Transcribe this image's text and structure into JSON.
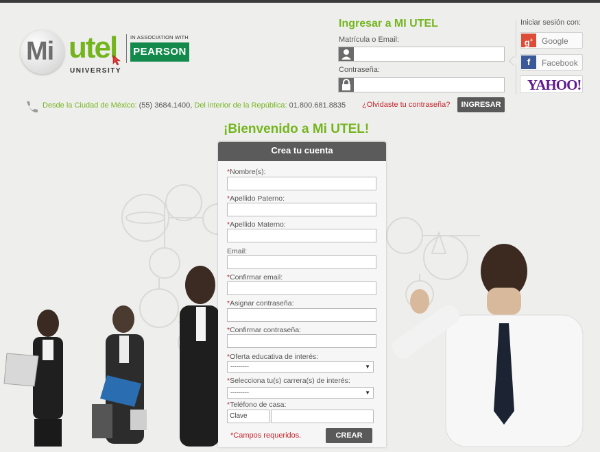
{
  "brand": {
    "logo_mi": "Mi",
    "logo_utel": "utel",
    "logo_university": "UNIVERSITY",
    "association": "IN ASSOCIATION WITH",
    "partner": "PEARSON"
  },
  "login": {
    "title": "Ingresar a MI UTEL",
    "user_label": "Matrícula o Email:",
    "password_label": "Contraseña:",
    "forgot_link": "¿Olvidaste tu contraseña?",
    "submit_label": "INGRESAR"
  },
  "social": {
    "title": "Iniciar sesión con:",
    "google_label": "Google",
    "facebook_label": "Facebook",
    "yahoo_label": "YAHOO!"
  },
  "contact": {
    "city_label": "Desde la Ciudad de México:",
    "city_phone": "(55) 3684.1400,",
    "country_label": "Del interior de la República:",
    "country_phone": "01.800.681.8835"
  },
  "welcome": "¡Bienvenido a Mi UTEL!",
  "form": {
    "title": "Crea tu cuenta",
    "required_mark": "*",
    "fields": {
      "nombre": "Nombre(s):",
      "apellido_paterno": "Apellido Paterno:",
      "apellido_materno": "Apellido Materno:",
      "email": "Email:",
      "confirmar_email": "Confirmar email:",
      "asignar_contrasena": "Asignar contraseña:",
      "confirmar_contrasena": "Confirmar contraseña:",
      "oferta": "Oferta educativa de interés:",
      "carrera": "Selecciona tu(s) carrera(s) de interés:",
      "telefono": "Teléfono de casa:"
    },
    "oferta_selected": "---------",
    "carrera_selected": "---------",
    "phone_area_value": "Clave",
    "required_note": "*Campos requeridos.",
    "submit_label": "CREAR"
  },
  "colors": {
    "brand_green": "#74b51e",
    "required_red": "#c4262e",
    "button_dark": "#595959",
    "pearson_green": "#138a4c",
    "yahoo_purple": "#5f1a8d",
    "google_red": "#dd4b39",
    "facebook_blue": "#3b5998"
  },
  "icons": [
    "user-icon",
    "lock-icon",
    "phone-icon",
    "google-plus-icon",
    "facebook-icon",
    "select-caret-icon"
  ]
}
